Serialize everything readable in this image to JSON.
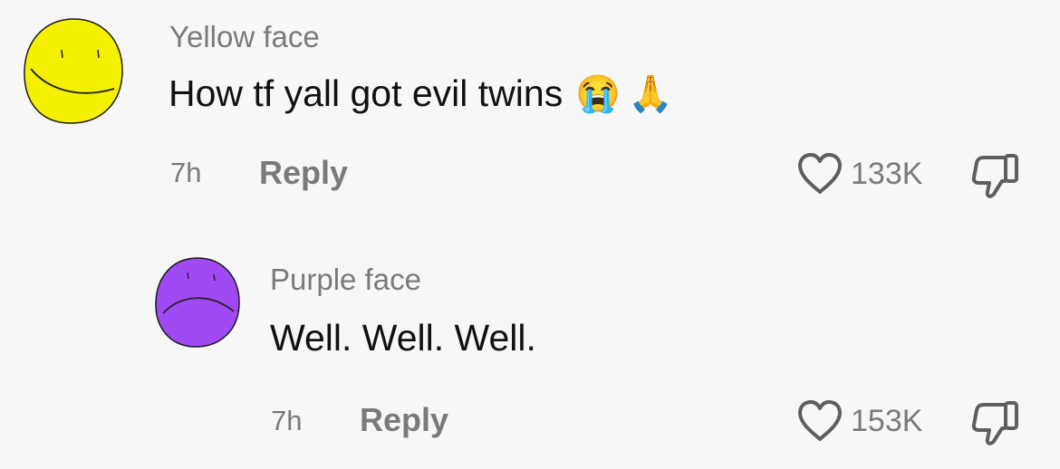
{
  "comments": [
    {
      "username": "Yellow face",
      "text": "How tf yall got evil twins",
      "emojis": [
        "😭",
        "🙏"
      ],
      "time": "7h",
      "reply_label": "Reply",
      "likes": "133K",
      "avatar_color": "#f5f000"
    },
    {
      "username": "Purple face",
      "text": "Well. Well. Well.",
      "time": "7h",
      "reply_label": "Reply",
      "likes": "153K",
      "avatar_color": "#a04af5"
    }
  ],
  "icons": {
    "like": "heart-outline-icon",
    "dislike": "thumbs-down-outline-icon"
  }
}
